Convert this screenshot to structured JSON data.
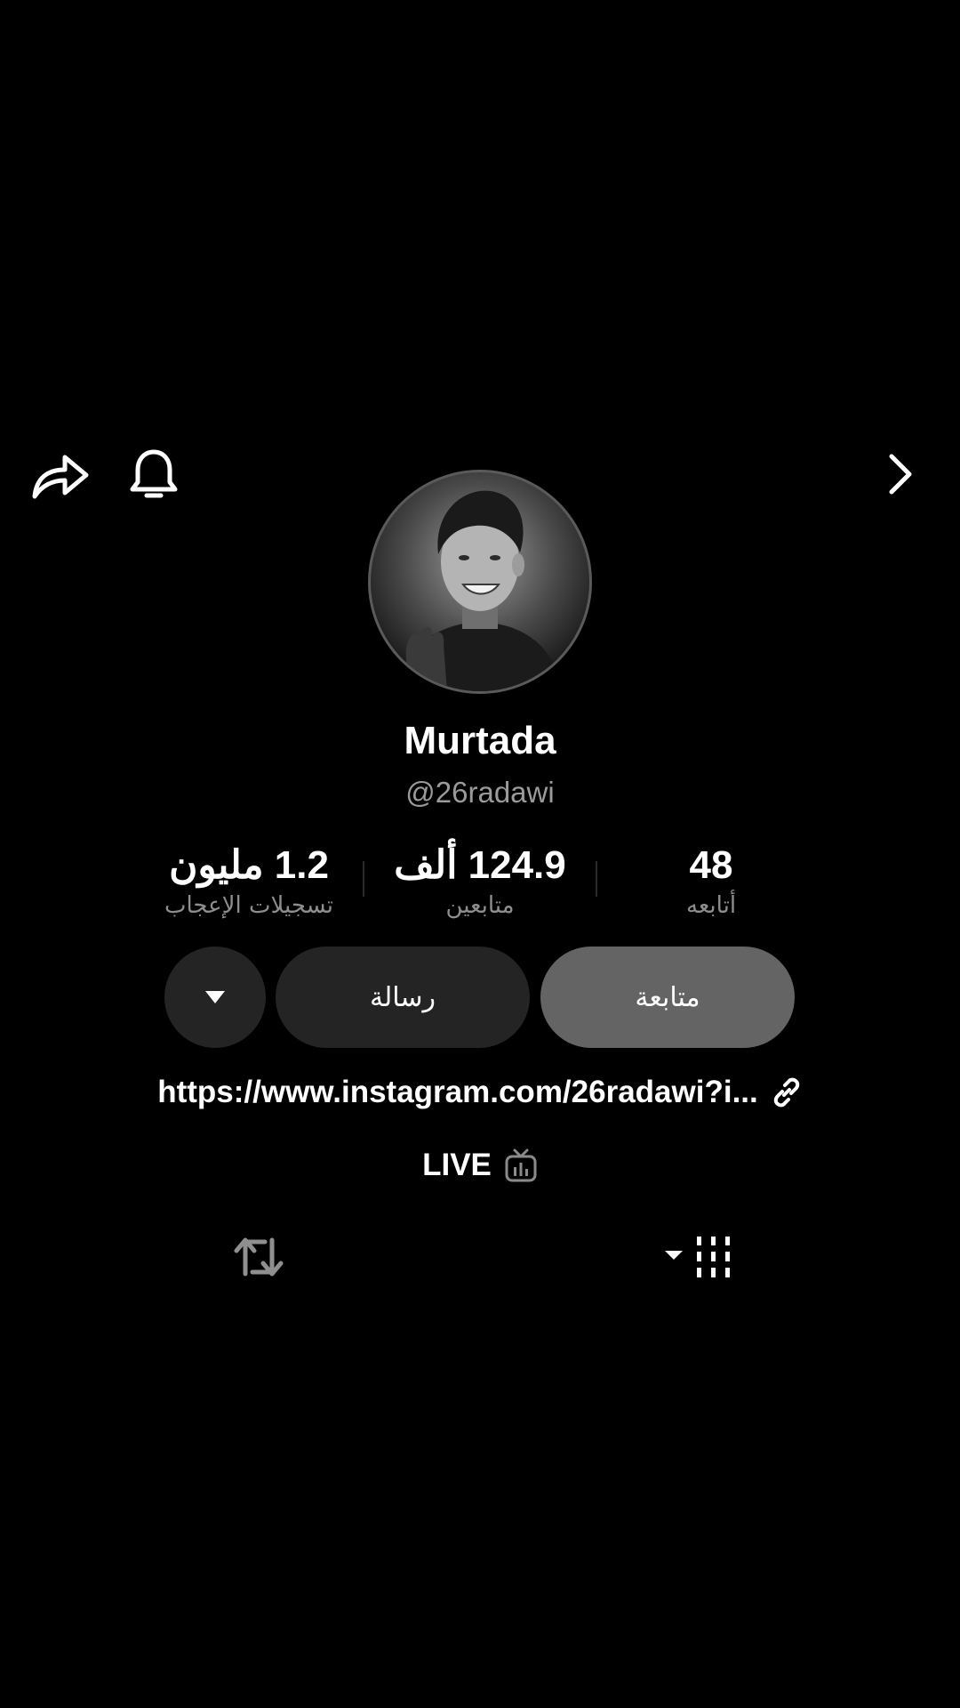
{
  "top_bar": {
    "share_icon": "share-arrow-icon",
    "bell_icon": "bell-icon",
    "next_icon": "chevron-right-icon"
  },
  "profile": {
    "name": "Murtada",
    "handle": "@26radawi"
  },
  "stats": {
    "likes": {
      "value": "1.2 مليون",
      "label": "تسجيلات الإعجاب"
    },
    "followers": {
      "value": "124.9 ألف",
      "label": "متابعين"
    },
    "following": {
      "value": "48",
      "label": "أتابعه"
    }
  },
  "actions": {
    "follow_label": "متابعة",
    "message_label": "رسالة",
    "more_icon": "caret-down-icon"
  },
  "bio": {
    "link": "https://www.instagram.com/26radawi?i..."
  },
  "live": {
    "label": "LIVE"
  },
  "tabs": {
    "repost_icon": "repost-icon",
    "grid_icon": "grid-icon"
  },
  "colors": {
    "background": "#000000",
    "follow_button": "#646464",
    "secondary_button": "#242424",
    "muted_text": "#9a9a9a"
  }
}
